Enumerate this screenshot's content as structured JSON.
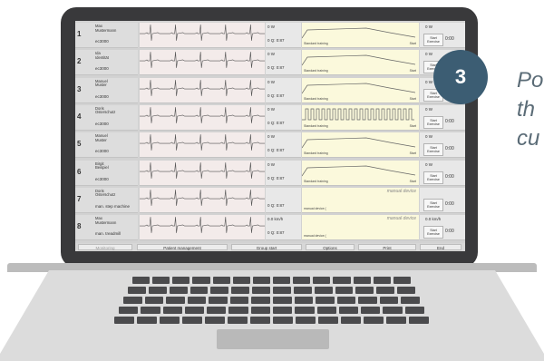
{
  "badge": {
    "number": "3"
  },
  "side_text": {
    "line1": "Po",
    "line2": "th",
    "line3": "cu"
  },
  "patients": [
    {
      "num": "1",
      "name": "Max\nMustermann",
      "device": "ec3000",
      "power": "0 W",
      "q": "0 Q: 0:87",
      "program": "Standard training",
      "start_label": "Start",
      "button": "Start\nExercise",
      "time": "0:00",
      "manual": ""
    },
    {
      "num": "2",
      "name": "Ida\nIdentität",
      "device": "ec3000",
      "power": "0 W",
      "q": "0 Q: 0:87",
      "program": "Standard training",
      "start_label": "Start",
      "button": "Start\nExercise",
      "time": "",
      "manual": ""
    },
    {
      "num": "3",
      "name": "Manuel\nMuster",
      "device": "ec3000",
      "power": "0 W",
      "q": "0 Q: 0:87",
      "program": "Standard training",
      "start_label": "Start",
      "button": "Start\nExercise",
      "time": "",
      "manual": ""
    },
    {
      "num": "4",
      "name": "Doris\nOsterschutz",
      "device": "ec3000",
      "power": "0 W",
      "q": "0 Q: 0:87",
      "program": "Standard training",
      "start_label": "Start",
      "button": "Start\nExercise",
      "time": "0:00",
      "manual": ""
    },
    {
      "num": "5",
      "name": "Manuel\nMuster",
      "device": "ec3000",
      "power": "0 W",
      "q": "0 Q: 0:87",
      "program": "Standard training",
      "start_label": "Start",
      "button": "Start\nExercise",
      "time": "0:00",
      "manual": ""
    },
    {
      "num": "6",
      "name": "Birgit\nBeispiel",
      "device": "ec3000",
      "power": "0 W",
      "q": "0 Q: 0:87",
      "program": "Standard training",
      "start_label": "Start",
      "button": "Start\nExercise",
      "time": "0:00",
      "manual": ""
    },
    {
      "num": "7",
      "name": "Doris\nOsterschutz",
      "device": "man. step machine",
      "power": "",
      "q": "0 Q: 0:87",
      "program": "manual device (",
      "start_label": "",
      "button": "Start\nExercise",
      "time": "0:00",
      "manual": "manual device"
    },
    {
      "num": "8",
      "name": "Max\nMustermann",
      "device": "man. treadmill",
      "power": "0.0 km/h",
      "q": "0 Q: 0:87",
      "program": "manual device (",
      "start_label": "",
      "button": "Start\nExercise",
      "time": "0:00",
      "manual": "manual device"
    }
  ],
  "bottom_buttons": {
    "monitoring": "Monitoring",
    "patient_management": "Patient management",
    "group_start": "Group start",
    "options": "Options",
    "print": "Print",
    "end": "End"
  }
}
